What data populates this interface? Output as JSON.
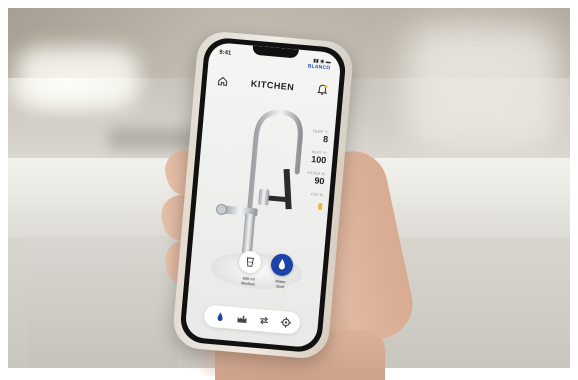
{
  "scene": {
    "description_visible": false
  },
  "app": {
    "status_time": "9:41",
    "brand": "BLANCO",
    "title": "KITCHEN"
  },
  "stats": [
    {
      "label": "TEMP °C",
      "value": "8"
    },
    {
      "label": "HEAT °C",
      "value": "100"
    },
    {
      "label": "FILTER %",
      "value": "90"
    },
    {
      "label": "CO2 %",
      "value": ""
    }
  ],
  "controls": {
    "cup_label_line1": "600 ml",
    "cup_label_line2": "Medium",
    "water_label_line1": "Water",
    "water_label_line2": "Start"
  },
  "colors": {
    "accent": "#1c44a8",
    "co2_indicator": "#f2b530"
  },
  "icons": [
    "home-icon",
    "bell-icon",
    "water-drop-icon",
    "factory-icon",
    "swap-icon",
    "settings-icon",
    "cup-icon"
  ]
}
